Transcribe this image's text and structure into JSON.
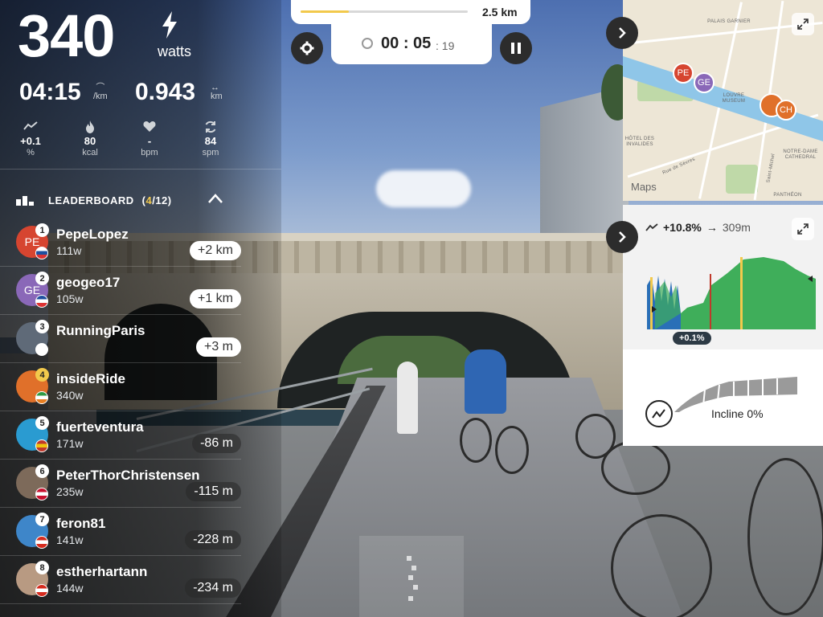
{
  "metrics": {
    "power_value": "340",
    "power_unit": "watts",
    "pace_value": "04:15",
    "pace_unit": "/km",
    "distance_value": "0.943",
    "distance_unit": "km",
    "mini_stats": [
      {
        "icon": "incline-icon",
        "value": "+0.1",
        "unit": "%"
      },
      {
        "icon": "flame-icon",
        "value": "80",
        "unit": "kcal"
      },
      {
        "icon": "heart-icon",
        "value": "-",
        "unit": "bpm"
      },
      {
        "icon": "cadence-icon",
        "value": "84",
        "unit": "spm"
      }
    ]
  },
  "leaderboard": {
    "title": "LEADERBOARD",
    "count_open": "(",
    "position": "4",
    "count_rest": "/12)",
    "rows": [
      {
        "rank": "1",
        "initials": "PE",
        "name": "PepeLopez",
        "sub": "111w",
        "gap": "+2 km",
        "ahead": true,
        "avatar_color": "#d64530",
        "flag_colors": [
          "#ffffff",
          "#1f4fa0",
          "#d33"
        ]
      },
      {
        "rank": "2",
        "initials": "GE",
        "name": "geogeo17",
        "sub": "105w",
        "gap": "+1 km",
        "ahead": true,
        "avatar_color": "#8a68b8",
        "flag_colors": [
          "#1f4fa0",
          "#ffffff",
          "#d33"
        ]
      },
      {
        "rank": "3",
        "initials": "",
        "name": "RunningParis",
        "sub": "",
        "gap": "+3 m",
        "ahead": true,
        "avatar_color": "#5f6a78",
        "flag_colors": [
          "#1f4fa0",
          "#ffffff",
          "#d33"
        ]
      },
      {
        "rank": "4",
        "initials": "",
        "name": "insideRide",
        "sub": "340w",
        "gap": "",
        "ahead": false,
        "avatar_color": "#e0702a",
        "flag_colors": [
          "#2f9a45",
          "#ffffff",
          "#e67e22"
        ]
      },
      {
        "rank": "5",
        "initials": "",
        "name": "fuerteventura",
        "sub": "171w",
        "gap": "-86 m",
        "ahead": false,
        "avatar_color": "#2a9bd1",
        "flag_colors": [
          "#c0392b",
          "#f1c40f",
          "#c0392b"
        ]
      },
      {
        "rank": "6",
        "initials": "",
        "name": "PeterThorChristensen",
        "sub": "235w",
        "gap": "-115 m",
        "ahead": false,
        "avatar_color": "#7d6a5a",
        "flag_colors": [
          "#c8102e",
          "#ffffff",
          "#c8102e"
        ]
      },
      {
        "rank": "7",
        "initials": "",
        "name": "feron81",
        "sub": "141w",
        "gap": "-228 m",
        "ahead": false,
        "avatar_color": "#3e86c9",
        "flag_colors": [
          "#d52b1e",
          "#ffffff",
          "#d52b1e"
        ]
      },
      {
        "rank": "8",
        "initials": "",
        "name": "estherhartann",
        "sub": "144w",
        "gap": "-234 m",
        "ahead": false,
        "avatar_color": "#b89a82",
        "flag_colors": [
          "#d52b1e",
          "#ffffff",
          "#d52b1e"
        ]
      }
    ]
  },
  "route": {
    "length": "2.5 km",
    "progress_fraction": 0.29
  },
  "timer": {
    "main_minutes": "00",
    "main_sep": ":",
    "main_seconds": "05",
    "ms_sep": ":",
    "ms": "19"
  },
  "map": {
    "brand": "Maps",
    "labels": {
      "palais_garnier": "PALAIS GARNIER",
      "louvre_museum": "LOUVRE MUSEUM",
      "hotel_des_invalides": "HÔTEL DES INVALIDES",
      "notre_dame": "NOTRE-DAME CATHEDRAL",
      "pantheon": "PANTHÉON",
      "rue_de_sevres": "Rue de Sèvres",
      "saint_michel": "Saint-Michel"
    },
    "pins": [
      {
        "label": "PE",
        "color": "#d64530"
      },
      {
        "label": "GE",
        "color": "#8a68b8"
      },
      {
        "label": "CH",
        "color": "#e0702a"
      }
    ]
  },
  "elevation": {
    "grade": "+10.8%",
    "distance": "309m",
    "current_incline": "+0.1%",
    "incline_label": "Incline 0%"
  },
  "colors": {
    "accent": "#f2c94c",
    "green_fill": "#3fae5a",
    "blue_fill": "#2a6fb7"
  }
}
